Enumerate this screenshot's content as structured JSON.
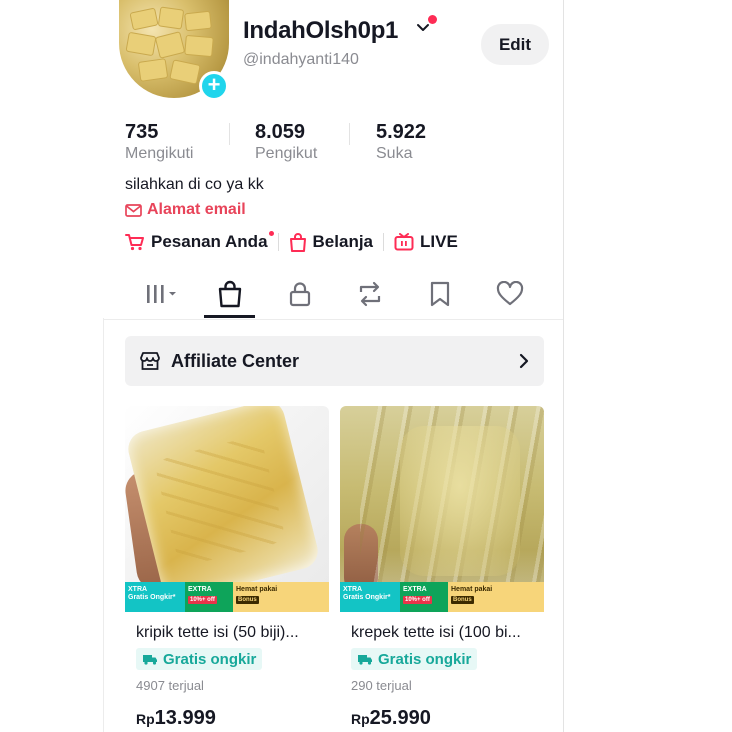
{
  "profile": {
    "username": "IndahOlsh0p1",
    "handle": "@indahyanti140",
    "edit_label": "Edit",
    "bio": "silahkan di co ya kk",
    "email_label": "Alamat email"
  },
  "stats": [
    {
      "value": "735",
      "label": "Mengikuti"
    },
    {
      "value": "8.059",
      "label": "Pengikut"
    },
    {
      "value": "5.922",
      "label": "Suka"
    }
  ],
  "quick_links": [
    {
      "label": "Pesanan Anda",
      "icon": "cart-icon"
    },
    {
      "label": "Belanja",
      "icon": "shopping-bag-icon"
    },
    {
      "label": "LIVE",
      "icon": "live-tv-icon"
    }
  ],
  "tabs": [
    {
      "icon": "grid-menu-icon",
      "active": false
    },
    {
      "icon": "shopping-bag-icon",
      "active": true
    },
    {
      "icon": "lock-icon",
      "active": false
    },
    {
      "icon": "repost-icon",
      "active": false
    },
    {
      "icon": "bookmark-icon",
      "active": false
    },
    {
      "icon": "heart-icon",
      "active": false
    }
  ],
  "affiliate": {
    "label": "Affiliate Center"
  },
  "products": [
    {
      "title": "kripik tette isi (50 biji)...",
      "shipping": "Gratis ongkir",
      "sold": "4907 terjual",
      "currency": "Rp",
      "price": "13.999",
      "promo": {
        "p1a": "XTRA",
        "p1b": "Gratis Ongkir*",
        "p2a": "EXTRA",
        "p2b": "10%+ off",
        "p3a": "Hemat pakai",
        "p3b": "Bonus"
      }
    },
    {
      "title": "krepek tette isi (100 bi...",
      "shipping": "Gratis ongkir",
      "sold": "290 terjual",
      "currency": "Rp",
      "price": "25.990",
      "promo": {
        "p1a": "XTRA",
        "p1b": "Gratis Ongkir*",
        "p2a": "EXTRA",
        "p2b": "10%+ off",
        "p3a": "Hemat pakai",
        "p3b": "Bonus"
      }
    }
  ],
  "colors": {
    "accent": "#fe2c55",
    "email": "#e8445a",
    "teal": "#20d5ec",
    "shipping": "#17a89a"
  }
}
